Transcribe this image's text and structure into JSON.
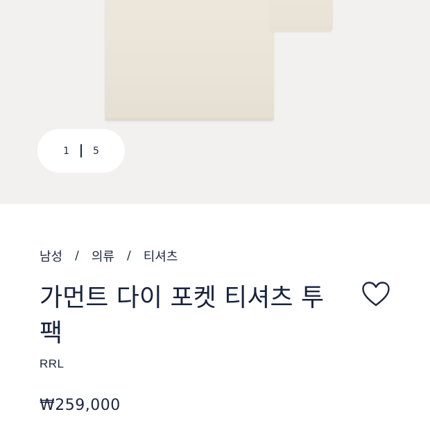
{
  "gallery": {
    "current_image": "1",
    "total_images": "5"
  },
  "breadcrumb": {
    "items": [
      "남성",
      "의류",
      "티셔츠"
    ],
    "separator": "/"
  },
  "product": {
    "title": "가먼트 다이 포켓 티셔츠 투팩",
    "brand": "RRL",
    "price": "₩259,000"
  },
  "icons": {
    "wishlist": "heart-outline-icon"
  },
  "colors": {
    "text_navy": "#1b2740",
    "gallery_bg": "#f2f1f0",
    "product_tint": "#ede7dc"
  }
}
